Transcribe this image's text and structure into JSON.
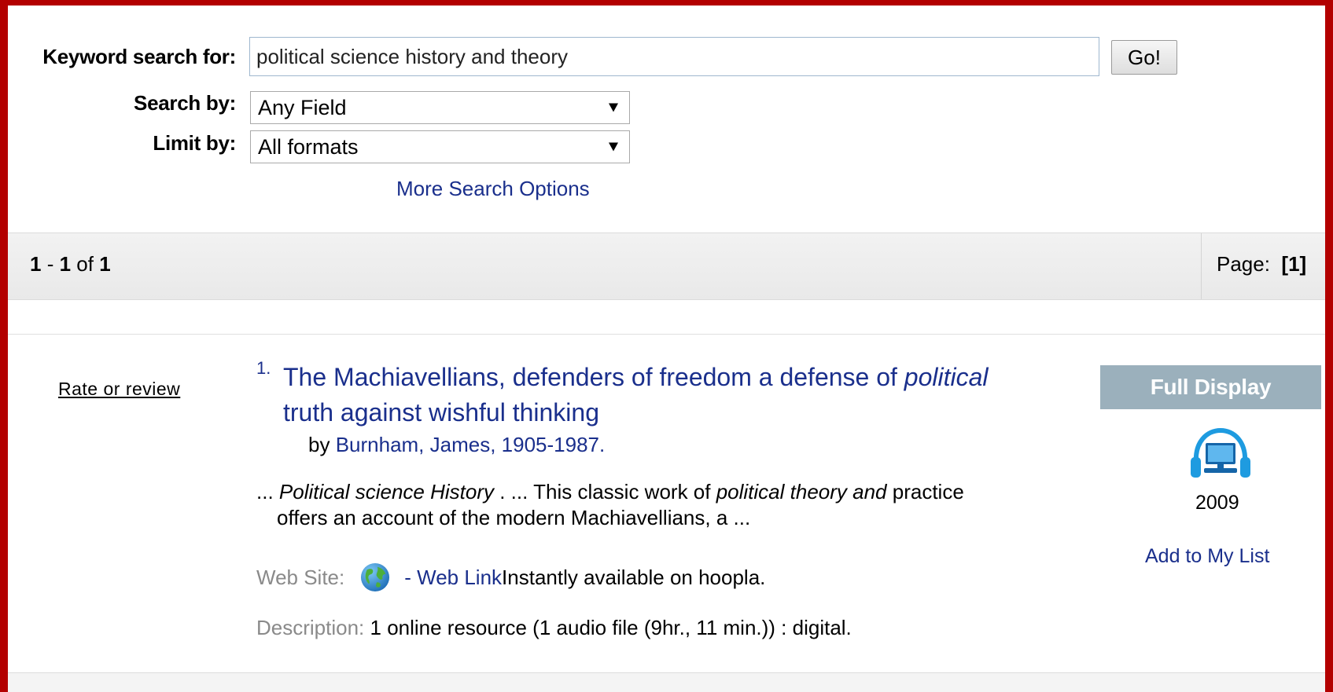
{
  "search": {
    "keyword_label": "Keyword search for:",
    "keyword_value": "political science history and theory",
    "go_label": "Go!",
    "searchby_label": "Search by:",
    "searchby_value": "Any Field",
    "limitby_label": "Limit by:",
    "limitby_value": "All formats",
    "more_options": "More Search Options"
  },
  "results_bar": {
    "range_start": "1",
    "range_sep": " - ",
    "range_end": "1",
    "of_word": " of ",
    "total": "1",
    "page_label": "Page:",
    "page_open": "[",
    "current_page": "1",
    "page_close": "]"
  },
  "record": {
    "rate_review": "Rate or review",
    "number": "1.",
    "title_part1": "The Machiavellians, defenders of freedom a defense of ",
    "title_italic": "political",
    "title_part2": " truth against wishful thinking",
    "author_prefix": "by ",
    "author_name": "Burnham, James, 1905-1987.",
    "snippet": {
      "p1": "... ",
      "i1": "Political science History",
      "p2": " . ... This classic work of ",
      "i2": "political theory and",
      "p3": " practice",
      "line2": "offers an account of the modern Machiavellians, a ..."
    },
    "website_label": "Web Site:",
    "website_link": "- Web Link",
    "website_note": " Instantly available on hoopla.",
    "description_label": "Description:",
    "description_value": " 1 online resource (1 audio file (9hr., 11 min.)) : digital.",
    "full_display": "Full Display",
    "format_icon": "audiobook-computer-headphones-icon",
    "year": "2009",
    "add_to_list": "Add to My List"
  },
  "colors": {
    "frame": "#b30000",
    "link": "#1a2f8c",
    "full_display_bg": "#9bb0bc"
  }
}
